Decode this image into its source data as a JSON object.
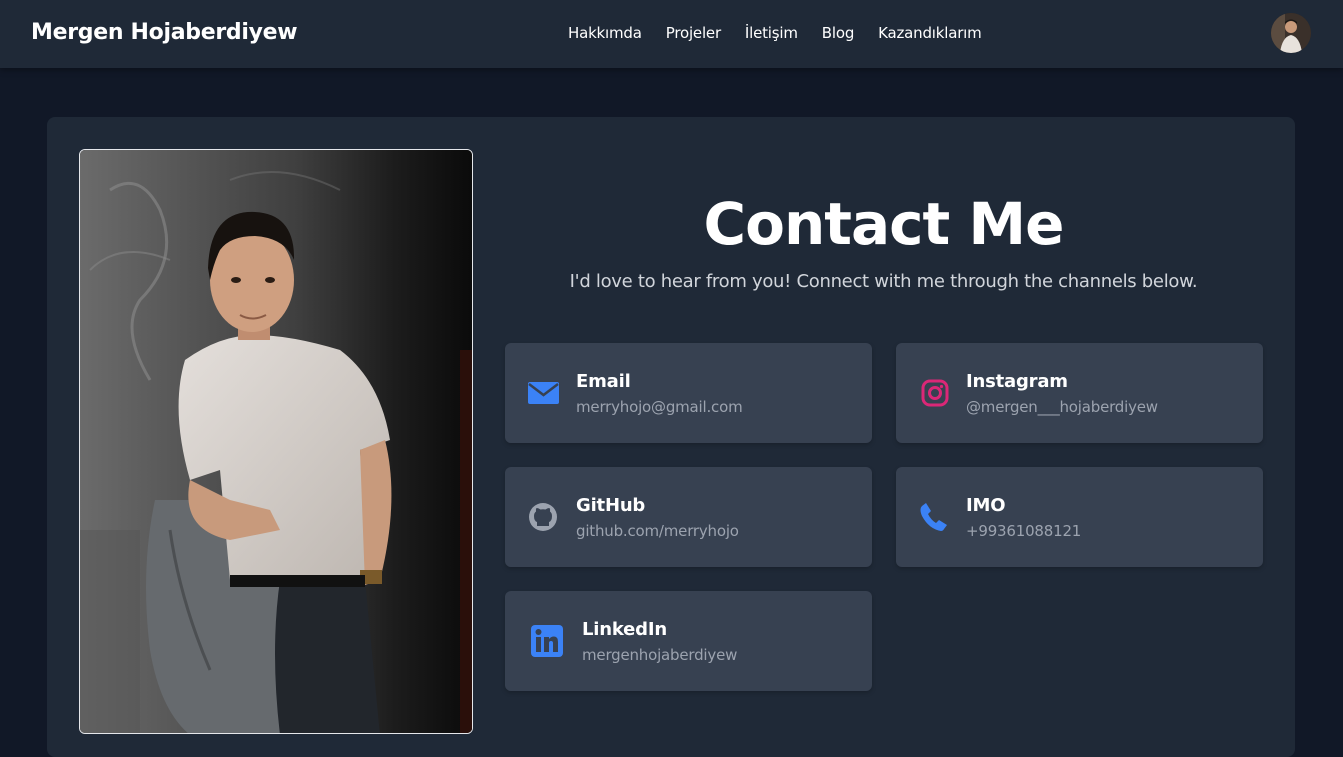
{
  "header": {
    "brand": "Mergen Hojaberdiyew",
    "nav": [
      "Hakkımda",
      "Projeler",
      "İletişim",
      "Blog",
      "Kazandıklarım"
    ],
    "avatar_icon": "profile-avatar"
  },
  "main": {
    "title": "Contact Me",
    "subtitle": "I'd love to hear from you! Connect with me through the channels below.",
    "contacts": [
      {
        "label": "Email",
        "value": "merryhojo@gmail.com",
        "icon": "envelope-icon",
        "color": "#3b82f6"
      },
      {
        "label": "Instagram",
        "value": "@mergen___hojaberdiyew",
        "icon": "instagram-icon",
        "color": "#db2777"
      },
      {
        "label": "GitHub",
        "value": "github.com/merryhojo",
        "icon": "github-icon",
        "color": "#9ca3af"
      },
      {
        "label": "IMO",
        "value": "+99361088121",
        "icon": "phone-icon",
        "color": "#3b82f6"
      },
      {
        "label": "LinkedIn",
        "value": "mergenhojaberdiyew",
        "icon": "linkedin-icon",
        "color": "#3b82f6"
      }
    ]
  },
  "colors": {
    "page_bg": "#111827",
    "surface": "#1f2937",
    "card": "#374151",
    "muted_text": "#9ca3af"
  }
}
